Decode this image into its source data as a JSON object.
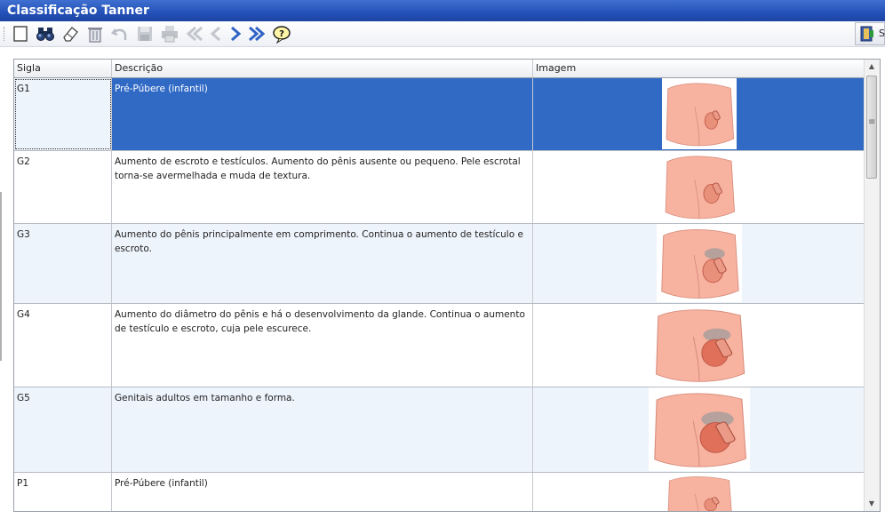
{
  "window": {
    "title": "Classificação Tanner"
  },
  "toolbar": {
    "buttons": [
      {
        "icon": "new-document-icon",
        "enabled": true
      },
      {
        "icon": "binoculars-icon",
        "enabled": true
      },
      {
        "icon": "eraser-icon",
        "enabled": true
      },
      {
        "icon": "trash-icon",
        "enabled": true
      },
      {
        "icon": "undo-icon",
        "enabled": false
      },
      {
        "icon": "save-icon",
        "enabled": false
      },
      {
        "icon": "print-icon",
        "enabled": false
      },
      {
        "icon": "first-record-icon",
        "enabled": false
      },
      {
        "icon": "previous-record-icon",
        "enabled": false
      },
      {
        "icon": "next-record-icon",
        "enabled": true
      },
      {
        "icon": "last-record-icon",
        "enabled": true
      },
      {
        "icon": "help-icon",
        "enabled": true
      }
    ],
    "right_button": {
      "icon": "exit-door-icon",
      "label": "S"
    }
  },
  "grid": {
    "columns": [
      "Sigla",
      "Descrição",
      "Imagem"
    ],
    "rows": [
      {
        "sigla": "G1",
        "descricao": "Pré-Púbere (infantil)",
        "stage": 1
      },
      {
        "sigla": "G2",
        "descricao": "Aumento de escroto e testículos. Aumento do pênis ausente ou pequeno. Pele escrotal torna-se avermelhada e muda de textura.",
        "stage": 2
      },
      {
        "sigla": "G3",
        "descricao": "Aumento do pênis principalmente em comprimento. Continua o aumento de testículo e escroto.",
        "stage": 3
      },
      {
        "sigla": "G4",
        "descricao": "Aumento do diâmetro do pênis e há o desenvolvimento da glande. Continua o aumento de testículo e escroto, cuja pele escurece.",
        "stage": 4
      },
      {
        "sigla": "G5",
        "descricao": "Genitais adultos em tamanho e forma.",
        "stage": 5
      },
      {
        "sigla": "P1",
        "descricao": "Pré-Púbere (infantil)",
        "stage": 1
      }
    ],
    "selected_row": 0
  },
  "colors": {
    "title_bar": "#2451b8",
    "selection": "#316ac5",
    "alt_row": "#eef4fc",
    "skin": "#f7b2a0"
  }
}
